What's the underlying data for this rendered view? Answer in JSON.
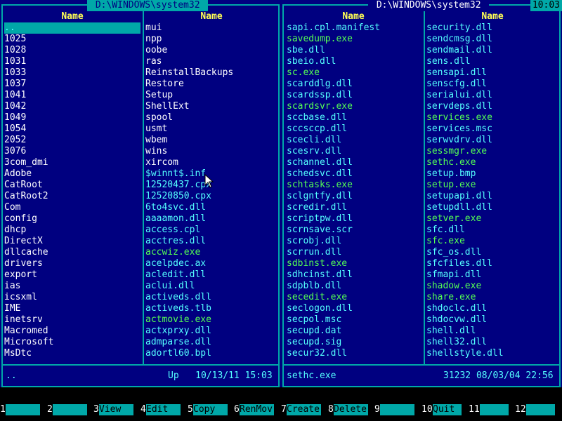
{
  "left_panel": {
    "path": " D:\\WINDOWS\\system32 ",
    "col1_header": "Name",
    "col2_header": "Name",
    "col1": [
      {
        "name": "..",
        "kind": "sel"
      },
      {
        "name": "1025"
      },
      {
        "name": "1028"
      },
      {
        "name": "1031"
      },
      {
        "name": "1033"
      },
      {
        "name": "1037"
      },
      {
        "name": "1041"
      },
      {
        "name": "1042"
      },
      {
        "name": "1049"
      },
      {
        "name": "1054"
      },
      {
        "name": "2052"
      },
      {
        "name": "3076"
      },
      {
        "name": "3com_dmi"
      },
      {
        "name": "Adobe"
      },
      {
        "name": "CatRoot"
      },
      {
        "name": "CatRoot2"
      },
      {
        "name": "Com"
      },
      {
        "name": "config"
      },
      {
        "name": "dhcp"
      },
      {
        "name": "DirectX"
      },
      {
        "name": "dllcache"
      },
      {
        "name": "drivers"
      },
      {
        "name": "export"
      },
      {
        "name": "ias"
      },
      {
        "name": "icsxml"
      },
      {
        "name": "IME"
      },
      {
        "name": "inetsrv"
      },
      {
        "name": "Macromed"
      },
      {
        "name": "Microsoft"
      },
      {
        "name": "MsDtc"
      }
    ],
    "col2": [
      {
        "name": "mui"
      },
      {
        "name": "npp"
      },
      {
        "name": "oobe"
      },
      {
        "name": "ras"
      },
      {
        "name": "ReinstallBackups"
      },
      {
        "name": "Restore"
      },
      {
        "name": "Setup"
      },
      {
        "name": "ShellExt"
      },
      {
        "name": "spool"
      },
      {
        "name": "usmt"
      },
      {
        "name": "wbem"
      },
      {
        "name": "wins"
      },
      {
        "name": "xircom"
      },
      {
        "name": "$winnt$.inf",
        "kind": "cyan"
      },
      {
        "name": "12520437.cpx",
        "kind": "cyan"
      },
      {
        "name": "12520850.cpx",
        "kind": "cyan"
      },
      {
        "name": "6to4svc.dll",
        "kind": "cyan"
      },
      {
        "name": "aaaamon.dll",
        "kind": "cyan"
      },
      {
        "name": "access.cpl",
        "kind": "cyan"
      },
      {
        "name": "acctres.dll",
        "kind": "cyan"
      },
      {
        "name": "accwiz.exe",
        "kind": "green"
      },
      {
        "name": "acelpdec.ax",
        "kind": "cyan"
      },
      {
        "name": "acledit.dll",
        "kind": "cyan"
      },
      {
        "name": "aclui.dll",
        "kind": "cyan"
      },
      {
        "name": "activeds.dll",
        "kind": "cyan"
      },
      {
        "name": "activeds.tlb",
        "kind": "cyan"
      },
      {
        "name": "actmovie.exe",
        "kind": "green"
      },
      {
        "name": "actxprxy.dll",
        "kind": "cyan"
      },
      {
        "name": "admparse.dll",
        "kind": "cyan"
      },
      {
        "name": "adortl60.bpl",
        "kind": "cyan"
      }
    ],
    "status_name": "..",
    "status_info": "Up   10/13/11 15:03"
  },
  "right_panel": {
    "path": " D:\\WINDOWS\\system32 ",
    "clock": "10:03",
    "col1_header": "Name",
    "col2_header": "Name",
    "col1": [
      {
        "name": "sapi.cpl.manifest",
        "kind": "cyan"
      },
      {
        "name": "savedump.exe",
        "kind": "green"
      },
      {
        "name": "sbe.dll",
        "kind": "cyan"
      },
      {
        "name": "sbeio.dll",
        "kind": "cyan"
      },
      {
        "name": "sc.exe",
        "kind": "green"
      },
      {
        "name": "scarddlg.dll",
        "kind": "cyan"
      },
      {
        "name": "scardssp.dll",
        "kind": "cyan"
      },
      {
        "name": "scardsvr.exe",
        "kind": "green"
      },
      {
        "name": "sccbase.dll",
        "kind": "cyan"
      },
      {
        "name": "sccsccp.dll",
        "kind": "cyan"
      },
      {
        "name": "scecli.dll",
        "kind": "cyan"
      },
      {
        "name": "scesrv.dll",
        "kind": "cyan"
      },
      {
        "name": "schannel.dll",
        "kind": "cyan"
      },
      {
        "name": "schedsvc.dll",
        "kind": "cyan"
      },
      {
        "name": "schtasks.exe",
        "kind": "green"
      },
      {
        "name": "sclgntfy.dll",
        "kind": "cyan"
      },
      {
        "name": "scredir.dll",
        "kind": "cyan"
      },
      {
        "name": "scriptpw.dll",
        "kind": "cyan"
      },
      {
        "name": "scrnsave.scr",
        "kind": "cyan"
      },
      {
        "name": "scrobj.dll",
        "kind": "cyan"
      },
      {
        "name": "scrrun.dll",
        "kind": "cyan"
      },
      {
        "name": "sdbinst.exe",
        "kind": "green"
      },
      {
        "name": "sdhcinst.dll",
        "kind": "cyan"
      },
      {
        "name": "sdpblb.dll",
        "kind": "cyan"
      },
      {
        "name": "secedit.exe",
        "kind": "green"
      },
      {
        "name": "seclogon.dll",
        "kind": "cyan"
      },
      {
        "name": "secpol.msc",
        "kind": "cyan"
      },
      {
        "name": "secupd.dat",
        "kind": "cyan"
      },
      {
        "name": "secupd.sig",
        "kind": "cyan"
      },
      {
        "name": "secur32.dll",
        "kind": "cyan"
      }
    ],
    "col2": [
      {
        "name": "security.dll",
        "kind": "cyan"
      },
      {
        "name": "sendcmsg.dll",
        "kind": "cyan"
      },
      {
        "name": "sendmail.dll",
        "kind": "cyan"
      },
      {
        "name": "sens.dll",
        "kind": "cyan"
      },
      {
        "name": "sensapi.dll",
        "kind": "cyan"
      },
      {
        "name": "senscfg.dll",
        "kind": "cyan"
      },
      {
        "name": "serialui.dll",
        "kind": "cyan"
      },
      {
        "name": "servdeps.dll",
        "kind": "cyan"
      },
      {
        "name": "services.exe",
        "kind": "green"
      },
      {
        "name": "services.msc",
        "kind": "cyan"
      },
      {
        "name": "serwvdrv.dll",
        "kind": "cyan"
      },
      {
        "name": "sessmgr.exe",
        "kind": "green"
      },
      {
        "name": "sethc.exe",
        "kind": "green"
      },
      {
        "name": "setup.bmp",
        "kind": "cyan"
      },
      {
        "name": "setup.exe",
        "kind": "green"
      },
      {
        "name": "setupapi.dll",
        "kind": "cyan"
      },
      {
        "name": "setupdll.dll",
        "kind": "cyan"
      },
      {
        "name": "setver.exe",
        "kind": "green"
      },
      {
        "name": "sfc.dll",
        "kind": "cyan"
      },
      {
        "name": "sfc.exe",
        "kind": "green"
      },
      {
        "name": "sfc_os.dll",
        "kind": "cyan"
      },
      {
        "name": "sfcfiles.dll",
        "kind": "cyan"
      },
      {
        "name": "sfmapi.dll",
        "kind": "cyan"
      },
      {
        "name": "shadow.exe",
        "kind": "green"
      },
      {
        "name": "share.exe",
        "kind": "green"
      },
      {
        "name": "shdoclc.dll",
        "kind": "cyan"
      },
      {
        "name": "shdocvw.dll",
        "kind": "cyan"
      },
      {
        "name": "shell.dll",
        "kind": "cyan"
      },
      {
        "name": "shell32.dll",
        "kind": "cyan"
      },
      {
        "name": "shellstyle.dll",
        "kind": "cyan"
      }
    ],
    "status_name": "sethc.exe",
    "status_info": "31232 08/03/04 22:56"
  },
  "fkeys": [
    {
      "num": "1",
      "label": ""
    },
    {
      "num": "2",
      "label": ""
    },
    {
      "num": "3",
      "label": "View"
    },
    {
      "num": "4",
      "label": "Edit"
    },
    {
      "num": "5",
      "label": "Copy"
    },
    {
      "num": "6",
      "label": "RenMov"
    },
    {
      "num": "7",
      "label": "Create"
    },
    {
      "num": "8",
      "label": "Delete"
    },
    {
      "num": "9",
      "label": ""
    },
    {
      "num": "10",
      "label": "Quit"
    },
    {
      "num": "11",
      "label": ""
    },
    {
      "num": "12",
      "label": ""
    }
  ],
  "colors": {
    "panel_bg": "#000080",
    "frame": "#00a8a8",
    "header": "#ffff54",
    "file": "#54ffff",
    "exe": "#54ff54",
    "dir": "#ffffff"
  }
}
